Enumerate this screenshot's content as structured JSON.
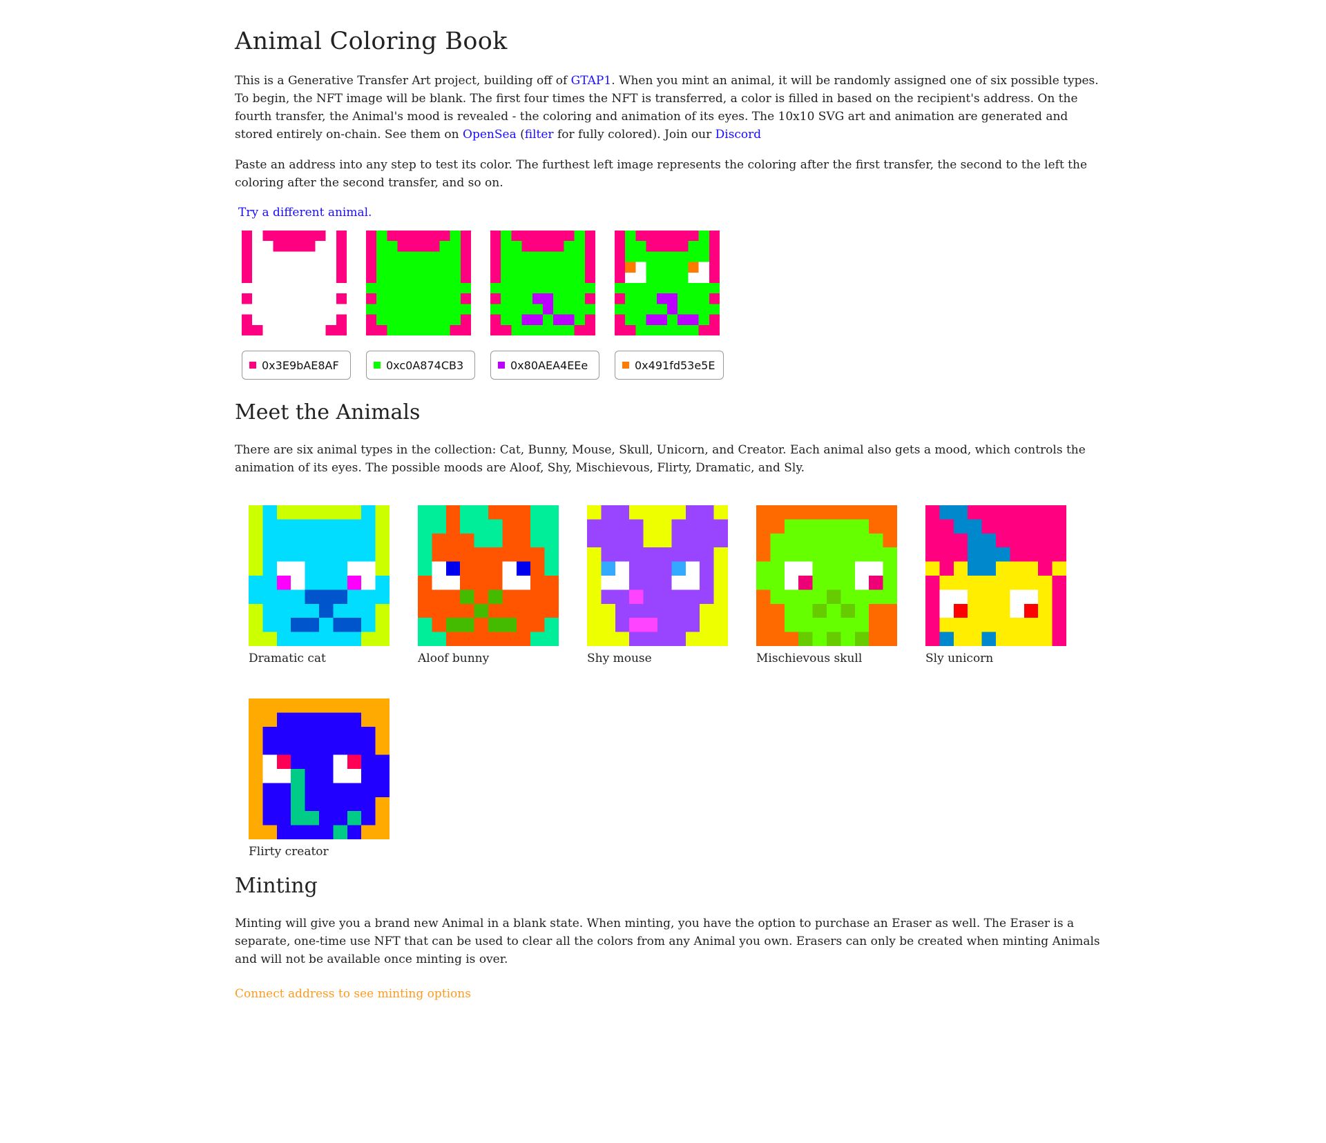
{
  "title": "Animal Coloring Book",
  "intro": {
    "t1": "This is a Generative Transfer Art project, building off of ",
    "link_gtap1": "GTAP1",
    "t2": ". When you mint an animal, it will be randomly assigned one of six possible types. To begin, the NFT image will be blank. The first four times the NFT is transferred, a color is filled in based on the recipient's address. On the fourth transfer, the Animal's mood is revealed - the coloring and animation of its eyes. The 10x10 SVG art and animation are generated and stored entirely on-chain. See them on ",
    "link_opensea": "OpenSea",
    "t3": " (",
    "link_filter": "filter",
    "t4": " for fully colored). Join our ",
    "link_discord": "Discord"
  },
  "paste_text": "Paste an address into any step to test its color. The furthest left image represents the coloring after the first transfer, the second to the left the coloring after the second transfer, and so on.",
  "try_link": "Try a different animal.",
  "colors": {
    "pink": "#ff0080",
    "green": "#09ff00",
    "purple": "#bb00ff",
    "orange": "#ff7a00",
    "link": "#1a0dff",
    "mint_link": "#ff9a1f"
  },
  "steps": [
    {
      "address": "0x3E9bAE8AF",
      "swatch": "#ff0080"
    },
    {
      "address": "0xc0A874CB3",
      "swatch": "#09ff00"
    },
    {
      "address": "0x80AEA4EEe",
      "swatch": "#bb00ff"
    },
    {
      "address": "0x491fd53e5E",
      "swatch": "#ff7a00"
    }
  ],
  "meet_heading": "Meet the Animals",
  "meet_text": "There are six animal types in the collection: Cat, Bunny, Mouse, Skull, Unicorn, and Creator. Each animal also gets a mood, which controls the animation of its eyes. The possible moods are Aloof, Shy, Mischievous, Flirty, Dramatic, and Sly.",
  "animals": [
    {
      "caption": "Dramatic cat",
      "colors": {
        "bg": "#ccff00",
        "body": "#00ddff",
        "eye": "#ff00ff",
        "detail": "#0055cc"
      }
    },
    {
      "caption": "Aloof bunny",
      "colors": {
        "bg": "#00ee99",
        "body": "#ff5500",
        "eye": "#0000ee",
        "detail": "#44bb00"
      }
    },
    {
      "caption": "Shy mouse",
      "colors": {
        "bg": "#eeff00",
        "body": "#9944ff",
        "eye": "#33aaff",
        "detail": "#ff44ff"
      }
    },
    {
      "caption": "Mischievous skull",
      "colors": {
        "bg": "#ff6a00",
        "body": "#66ff00",
        "eye": "#ee0077",
        "detail": "#66cc00"
      }
    },
    {
      "caption": "Sly unicorn",
      "colors": {
        "bg": "#ff0080",
        "body": "#ffee00",
        "eye": "#ff0000",
        "detail": "#0088cc"
      }
    },
    {
      "caption": "Flirty creator",
      "colors": {
        "bg": "#ffaa00",
        "body": "#2200ff",
        "eye": "#ff0055",
        "detail": "#00cc88"
      }
    }
  ],
  "minting_heading": "Minting",
  "minting_text": "Minting will give you a brand new Animal in a blank state. When minting, you have the option to purchase an Eraser as well. The Eraser is a separate, one-time use NFT that can be used to clear all the colors from any Animal you own. Erasers can only be created when minting Animals and will not be available once minting is over.",
  "mint_link": "Connect address to see minting options"
}
